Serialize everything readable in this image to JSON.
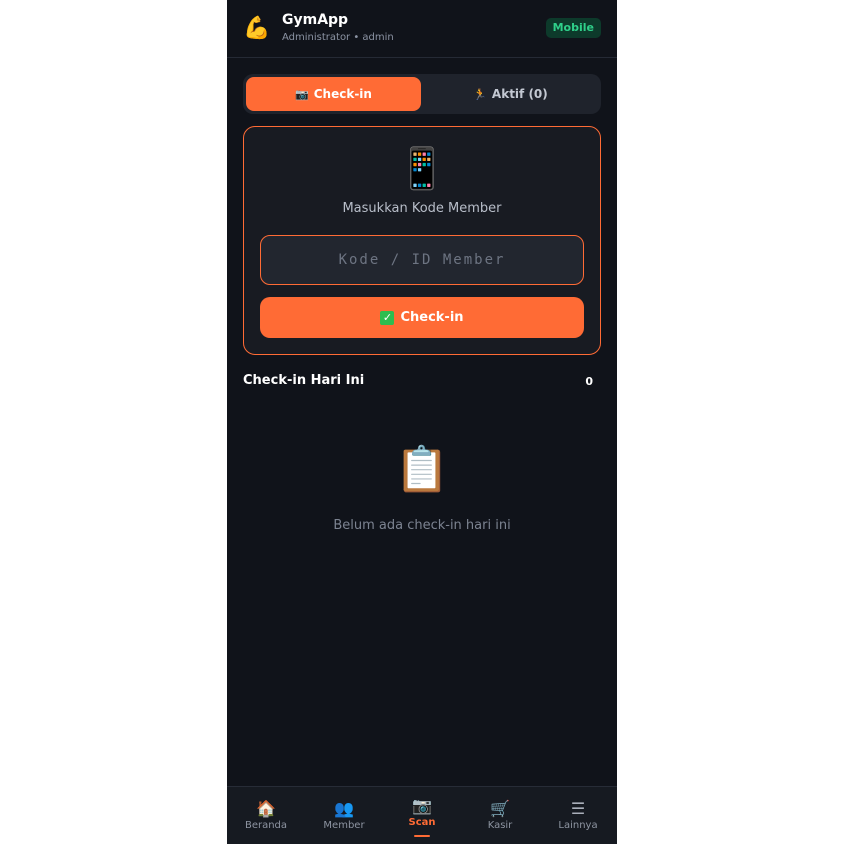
{
  "header": {
    "logo_icon": "💪",
    "title": "GymApp",
    "subtitle": "Administrator • admin",
    "badge": "Mobile"
  },
  "tabs": [
    {
      "icon": "📷",
      "label": "Check-in",
      "active": true
    },
    {
      "icon": "🏃",
      "label": "Aktif (0)",
      "active": false
    }
  ],
  "checkin_card": {
    "icon": "📱",
    "label": "Masukkan Kode Member",
    "input_value": "",
    "input_placeholder": "Kode / ID Member",
    "button_icon": "✓",
    "button_label": "Check-in"
  },
  "today": {
    "title": "Check-in Hari Ini",
    "count": "0",
    "empty_icon": "📋",
    "empty_text": "Belum ada check-in hari ini"
  },
  "bottom_nav": [
    {
      "icon": "🏠",
      "label": "Beranda",
      "active": false
    },
    {
      "icon": "👥",
      "label": "Member",
      "active": false
    },
    {
      "icon": "📷",
      "label": "Scan",
      "active": true
    },
    {
      "icon": "🛒",
      "label": "Kasir",
      "active": false
    },
    {
      "icon": "☰",
      "label": "Lainnya",
      "active": false
    }
  ],
  "colors": {
    "accent": "#ff6b35",
    "background": "#10131a",
    "badge_text": "#2fd08a"
  }
}
